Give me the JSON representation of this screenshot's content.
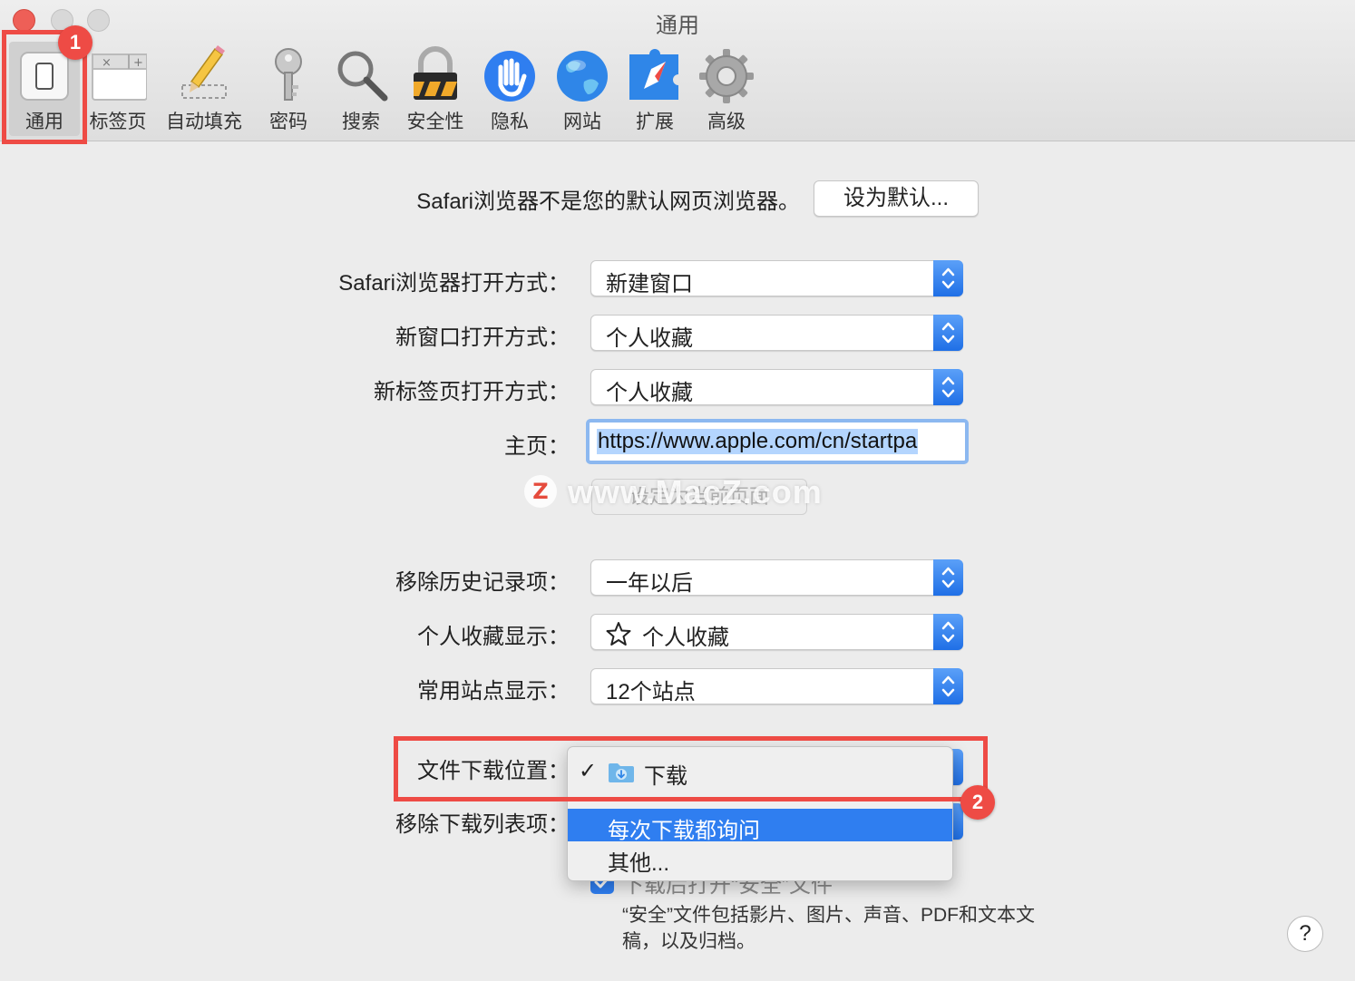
{
  "window": {
    "title": "通用"
  },
  "toolbar": {
    "tabs": [
      {
        "label": "通用",
        "icon": "general-switch-icon",
        "selected": true
      },
      {
        "label": "标签页",
        "icon": "tabs-icon"
      },
      {
        "label": "自动填充",
        "icon": "pencil-icon"
      },
      {
        "label": "密码",
        "icon": "key-icon"
      },
      {
        "label": "搜索",
        "icon": "magnifier-icon"
      },
      {
        "label": "安全性",
        "icon": "padlock-icon"
      },
      {
        "label": "隐私",
        "icon": "hand-icon"
      },
      {
        "label": "网站",
        "icon": "globe-icon"
      },
      {
        "label": "扩展",
        "icon": "compass-puzzle-icon"
      },
      {
        "label": "高级",
        "icon": "gear-icon"
      }
    ]
  },
  "general": {
    "default_browser_text": "Safari浏览器不是您的默认网页浏览器。",
    "set_default_button": "设为默认...",
    "rows": [
      {
        "label": "Safari浏览器打开方式：",
        "value": "新建窗口"
      },
      {
        "label": "新窗口打开方式：",
        "value": "个人收藏"
      },
      {
        "label": "新标签页打开方式：",
        "value": "个人收藏"
      },
      {
        "label": "主页：",
        "value": "https://www.apple.com/cn/startpa"
      },
      {
        "label": "移除历史记录项：",
        "value": "一年以后"
      },
      {
        "label": "个人收藏显示：",
        "value": "个人收藏",
        "icon": "star-icon"
      },
      {
        "label": "常用站点显示：",
        "value": "12个站点"
      },
      {
        "label": "文件下载位置："
      },
      {
        "label": "移除下载列表项："
      }
    ],
    "set_current_page_button": "设定为当前页面",
    "open_safe_files_label": "下载后打开“安全”文件",
    "open_safe_files_checked": true,
    "safe_files_note": "“安全”文件包括影片、图片、声音、PDF和文本文稿，以及归档。",
    "help_button": "?"
  },
  "download_menu": {
    "items": [
      {
        "label": "下载",
        "checked": true,
        "icon": "downloads-folder-icon"
      },
      {
        "label": "每次下载都询问",
        "highlighted": true
      },
      {
        "label": "其他..."
      }
    ]
  },
  "annotations": {
    "markers": [
      "1",
      "2"
    ],
    "color": "#ee4b45"
  },
  "watermark": {
    "text": "www.MacZ.com",
    "logo": "Z"
  },
  "colors": {
    "accent": "#2f7ef0",
    "window_bg": "#ececec"
  }
}
